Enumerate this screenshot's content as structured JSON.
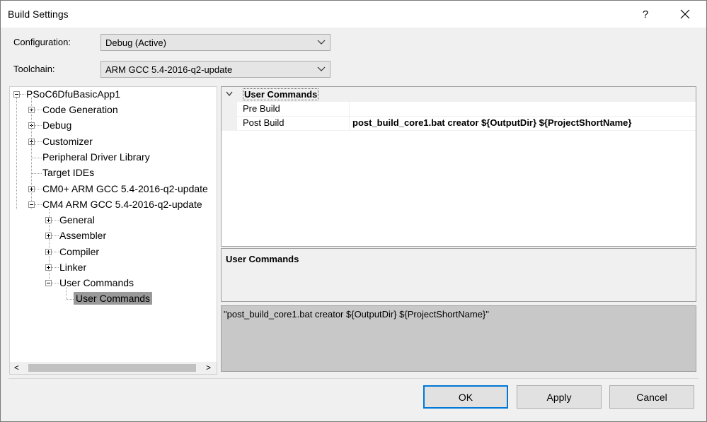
{
  "window": {
    "title": "Build Settings",
    "help_label": "?",
    "close_icon": "close-icon"
  },
  "configuration": {
    "label": "Configuration:",
    "value": "Debug (Active)"
  },
  "toolchain": {
    "label": "Toolchain:",
    "value": "ARM GCC 5.4-2016-q2-update"
  },
  "tree": {
    "root": "PSoC6DfuBasicApp1",
    "items": [
      {
        "label": "Code Generation"
      },
      {
        "label": "Debug"
      },
      {
        "label": "Customizer"
      },
      {
        "label": "Peripheral Driver Library"
      },
      {
        "label": "Target IDEs"
      },
      {
        "label": "CM0+ ARM GCC 5.4-2016-q2-update"
      },
      {
        "label": "CM4 ARM GCC 5.4-2016-q2-update"
      }
    ],
    "cm4_children": [
      {
        "label": "General"
      },
      {
        "label": "Assembler"
      },
      {
        "label": "Compiler"
      },
      {
        "label": "Linker"
      },
      {
        "label": "User Commands"
      }
    ],
    "selected": "User Commands",
    "scroll_left": "<",
    "scroll_right": ">"
  },
  "properties": {
    "category": "User Commands",
    "rows": [
      {
        "name": "Pre Build",
        "value": ""
      },
      {
        "name": "Post Build",
        "value": "post_build_core1.bat creator ${OutputDir} ${ProjectShortName}"
      }
    ]
  },
  "description": {
    "title": "User Commands"
  },
  "value_preview": "\"post_build_core1.bat creator ${OutputDir} ${ProjectShortName}\"",
  "buttons": {
    "ok": "OK",
    "apply": "Apply",
    "cancel": "Cancel"
  },
  "colors": {
    "accent": "#0078d7",
    "selection": "#999999"
  }
}
